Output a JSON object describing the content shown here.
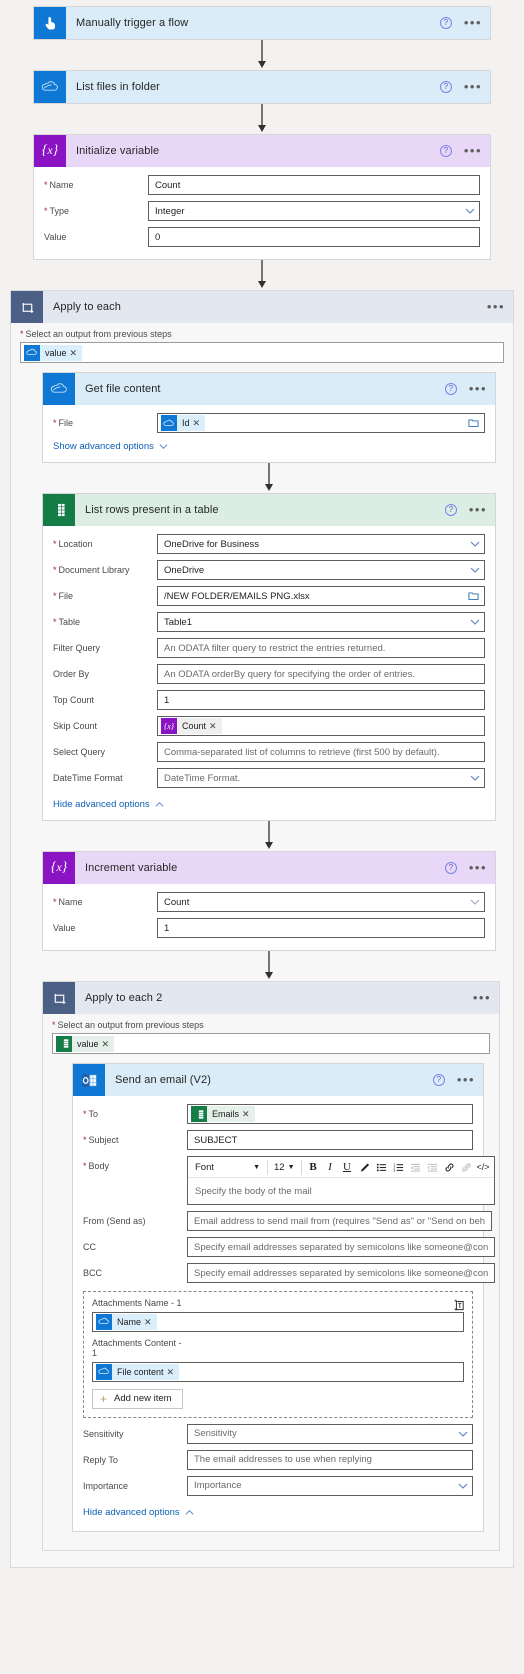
{
  "colors": {
    "blue": "#0f78d4",
    "purple": "#8a14c4",
    "green": "#147c45",
    "loop": "#4c5f85",
    "link": "#0b5fb5",
    "required": "#a4262c"
  },
  "steps": {
    "trigger": {
      "title": "Manually trigger a flow",
      "icon": "hand-tap-icon"
    },
    "list_files": {
      "title": "List files in folder",
      "icon": "onedrive-icon"
    },
    "initialize_variable": {
      "title": "Initialize variable",
      "icon": "variable-icon",
      "fields": {
        "name_label": "Name",
        "name_value": "Count",
        "type_label": "Type",
        "type_value": "Integer",
        "value_label": "Value",
        "value_value": "0"
      }
    },
    "apply_to_each": {
      "title": "Apply to each",
      "icon": "loop-icon",
      "select_label": "Select an output from previous steps",
      "select_token": "value"
    },
    "get_file_content": {
      "title": "Get file content",
      "icon": "onedrive-icon",
      "file_label": "File",
      "file_token": "Id",
      "advanced_link": "Show advanced options"
    },
    "list_rows": {
      "title": "List rows present in a table",
      "icon": "excel-icon",
      "fields": [
        {
          "label": "Location",
          "value": "OneDrive for Business",
          "required": true,
          "control": "dropdown"
        },
        {
          "label": "Document Library",
          "value": "OneDrive",
          "required": true,
          "control": "dropdown"
        },
        {
          "label": "File",
          "value": "/NEW FOLDER/EMAILS PNG.xlsx",
          "required": true,
          "control": "folder"
        },
        {
          "label": "Table",
          "value": "Table1",
          "required": true,
          "control": "dropdown"
        },
        {
          "label": "Filter Query",
          "value": "An ODATA filter query to restrict the entries returned.",
          "required": false,
          "control": "text",
          "placeholder": true
        },
        {
          "label": "Order By",
          "value": "An ODATA orderBy query for specifying the order of entries.",
          "required": false,
          "control": "text",
          "placeholder": true
        },
        {
          "label": "Top Count",
          "value": "1",
          "required": false,
          "control": "text",
          "placeholder": false
        },
        {
          "label": "Skip Count",
          "value": "Count",
          "required": false,
          "control": "token-var"
        },
        {
          "label": "Select Query",
          "value": "Comma-separated list of columns to retrieve (first 500 by default).",
          "required": false,
          "control": "text",
          "placeholder": true
        },
        {
          "label": "DateTime Format",
          "value": "DateTime Format.",
          "required": false,
          "control": "dropdown",
          "placeholder": true
        }
      ],
      "advanced_link": "Hide advanced options"
    },
    "increment_variable": {
      "title": "Increment variable",
      "icon": "variable-icon",
      "fields": {
        "name_label": "Name",
        "name_value": "Count",
        "value_label": "Value",
        "value_value": "1"
      }
    },
    "apply_to_each_2": {
      "title": "Apply to each 2",
      "icon": "loop-icon",
      "select_label": "Select an output from previous steps",
      "select_token": "value"
    },
    "send_email": {
      "title": "Send an email (V2)",
      "icon": "outlook-icon",
      "to_label": "To",
      "to_token": "Emails",
      "subject_label": "Subject",
      "subject_value": "SUBJECT",
      "body_label": "Body",
      "editor": {
        "font_name": "Font",
        "font_size": "12",
        "placeholder": "Specify the body of the mail",
        "tools": [
          "bold-icon",
          "italic-icon",
          "underline-icon",
          "font-color-icon",
          "bulleted-list-icon",
          "numbered-list-icon",
          "decrease-indent-icon",
          "increase-indent-icon",
          "link-icon",
          "unlink-icon",
          "code-view-icon"
        ]
      },
      "from_label": "From (Send as)",
      "from_placeholder": "Email address to send mail from (requires \"Send as\" or \"Send on beh",
      "cc_label": "CC",
      "cc_placeholder": "Specify email addresses separated by semicolons like someone@con",
      "bcc_label": "BCC",
      "bcc_placeholder": "Specify email addresses separated by semicolons like someone@con",
      "attachments": {
        "name_label": "Attachments Name - 1",
        "name_token": "Name",
        "content_label": "Attachments Content - 1",
        "content_token": "File content",
        "add_new_item": "Add new item",
        "copy_icon": "copy-item-icon"
      },
      "sensitivity_label": "Sensitivity",
      "sensitivity_value": "Sensitivity",
      "reply_to_label": "Reply To",
      "reply_to_placeholder": "The email addresses to use when replying",
      "importance_label": "Importance",
      "importance_value": "Importance",
      "advanced_link": "Hide advanced options"
    }
  }
}
